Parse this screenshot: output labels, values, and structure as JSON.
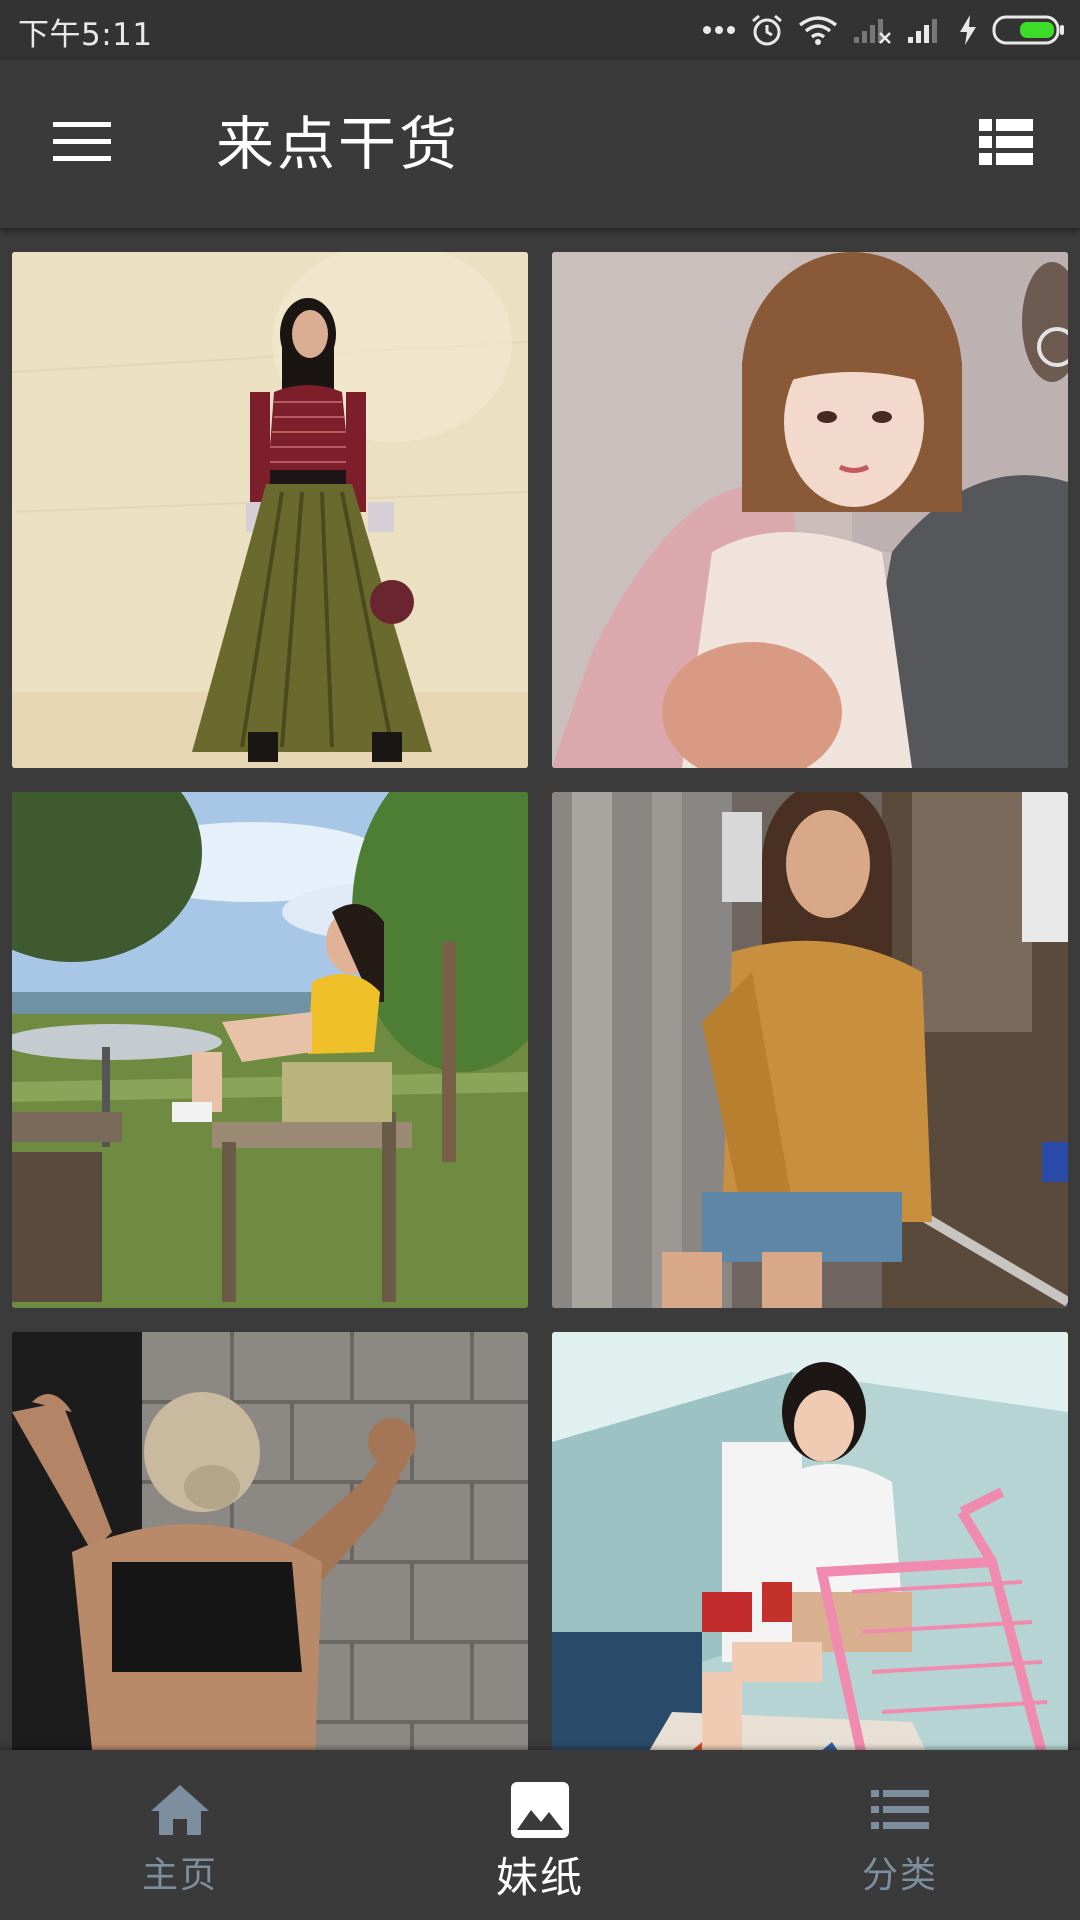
{
  "status_bar": {
    "time": "下午5:11",
    "icons": [
      "more-dots-icon",
      "alarm-icon",
      "wifi-icon",
      "no-signal-icon",
      "signal-icon",
      "charging-icon",
      "battery-icon"
    ],
    "battery_color": "#3ddc29"
  },
  "app_bar": {
    "title": "来点干货",
    "menu_icon": "hamburger-menu-icon",
    "view_icon": "list-view-icon"
  },
  "gallery": {
    "photos": [
      {
        "icon": "photo-thumbnail"
      },
      {
        "icon": "photo-thumbnail"
      },
      {
        "icon": "photo-thumbnail"
      },
      {
        "icon": "photo-thumbnail"
      },
      {
        "icon": "photo-thumbnail"
      },
      {
        "icon": "photo-thumbnail"
      }
    ]
  },
  "bottom_nav": {
    "items": [
      {
        "label": "主页",
        "icon": "home-icon",
        "active": false
      },
      {
        "label": "妹纸",
        "icon": "image-icon",
        "active": true
      },
      {
        "label": "分类",
        "icon": "list-icon",
        "active": false
      }
    ],
    "inactive_color": "#7d8f9e",
    "active_color": "#ffffff"
  }
}
